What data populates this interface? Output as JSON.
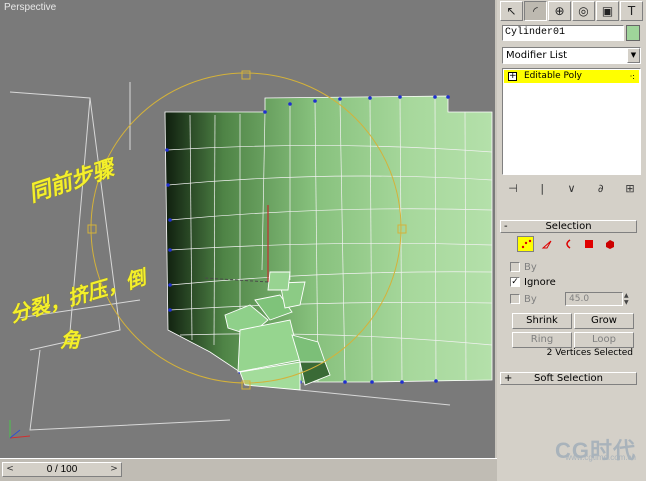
{
  "viewport": {
    "label": "Perspective",
    "annotations": [
      "同前步骤",
      "分裂，挤压，倒",
      "角"
    ]
  },
  "timeline": {
    "value": "0 / 100",
    "arrow_left": "<",
    "arrow_right": ">"
  },
  "watermark": {
    "logo": "CG时代",
    "url": "www.cgtime.com.cn"
  },
  "command_panel": {
    "tabs": [
      {
        "icon": "create-icon",
        "glyph": "↖"
      },
      {
        "icon": "modify-icon",
        "glyph": "◜"
      },
      {
        "icon": "hierarchy-icon",
        "glyph": "⊕"
      },
      {
        "icon": "motion-icon",
        "glyph": "◎"
      },
      {
        "icon": "display-icon",
        "glyph": "▣"
      },
      {
        "icon": "utilities-icon",
        "glyph": "T"
      }
    ],
    "object_name": "Cylinder01",
    "object_color": "#9fd49a",
    "modifier_list": "Modifier List",
    "stack_item": "Editable Poly",
    "stack_tools": [
      "⊣",
      "|",
      "∨",
      "∂",
      "⊞"
    ],
    "selection": {
      "title": "Selection",
      "sign": "-",
      "by_vertex_label": "By",
      "ignore_label": "Ignore",
      "by_angle_label": "By",
      "angle_value": "45.0",
      "shrink": "Shrink",
      "grow": "Grow",
      "ring": "Ring",
      "loop": "Loop",
      "status": "2 Vertices Selected"
    },
    "soft_selection": {
      "title": "Soft Selection",
      "sign": "+"
    }
  },
  "accent_colors": {
    "active_yellow": "#ffff00",
    "annotation_yellow": "#f4ef2c",
    "mesh_green": "#9fd49a"
  }
}
